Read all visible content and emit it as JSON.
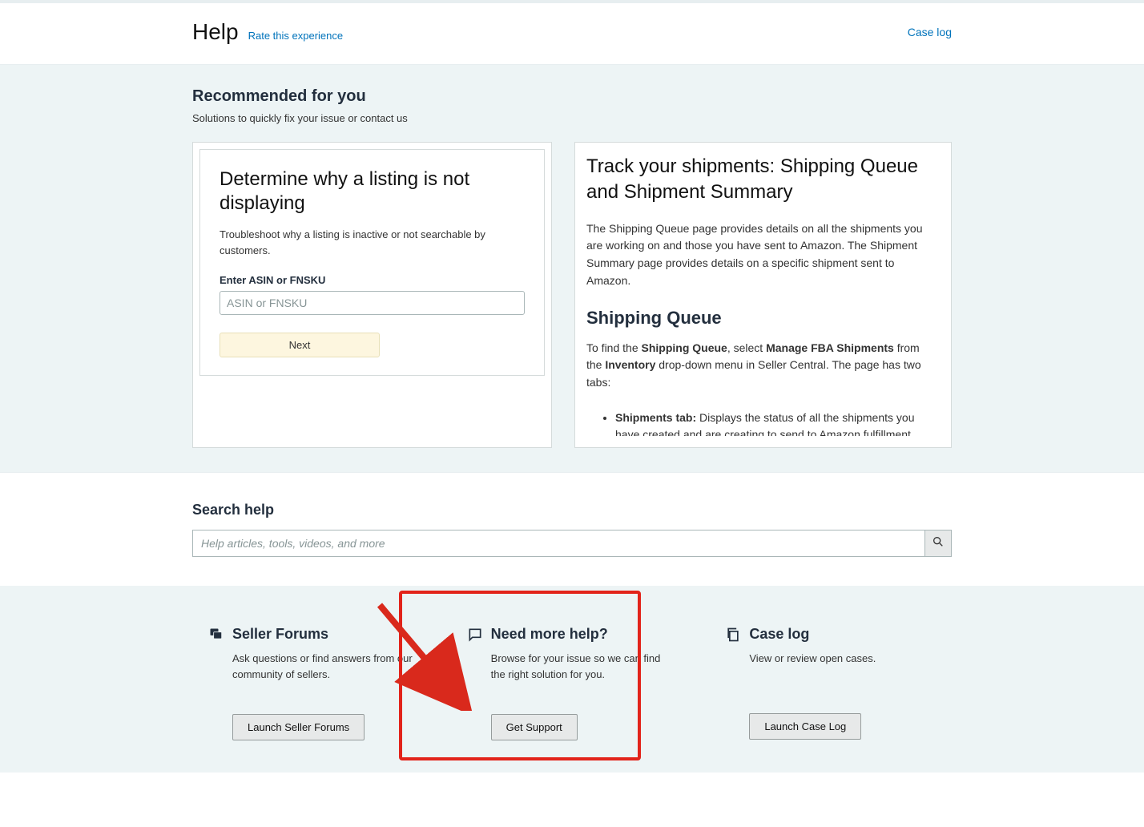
{
  "header": {
    "title": "Help",
    "rate_link": "Rate this experience",
    "caselog_link": "Case log"
  },
  "recommended": {
    "title": "Recommended for you",
    "subtitle": "Solutions to quickly fix your issue or contact us"
  },
  "listing_card": {
    "title": "Determine why a listing is not displaying",
    "desc": "Troubleshoot why a listing is inactive or not searchable by customers.",
    "field_label": "Enter ASIN or FNSKU",
    "placeholder": "ASIN or FNSKU",
    "next_label": "Next"
  },
  "article": {
    "title": "Track your shipments: Shipping Queue and Shipment Summary",
    "p1": "The Shipping Queue page provides details on all the shipments you are working on and those you have sent to Amazon. The Shipment Summary page provides details on a specific shipment sent to Amazon.",
    "h2": "Shipping Queue",
    "p2_a": "To find the ",
    "p2_b": "Shipping Queue",
    "p2_c": ", select ",
    "p2_d": "Manage FBA Shipments",
    "p2_e": " from the ",
    "p2_f": "Inventory",
    "p2_g": " drop-down menu in Seller Central. The page has two tabs:",
    "li1_a": "Shipments tab:",
    "li1_b": " Displays the status of all the shipments you have created and are creating to send to Amazon fulfillment"
  },
  "search": {
    "title": "Search help",
    "placeholder": "Help articles, tools, videos, and more"
  },
  "bottom": {
    "forums": {
      "title": "Seller Forums",
      "desc": "Ask questions or find answers from our community of sellers.",
      "button": "Launch Seller Forums"
    },
    "support": {
      "title": "Need more help?",
      "desc": "Browse for your issue so we can find the right solution for you.",
      "button": "Get Support"
    },
    "caselog": {
      "title": "Case log",
      "desc": "View or review open cases.",
      "button": "Launch Case Log"
    }
  }
}
